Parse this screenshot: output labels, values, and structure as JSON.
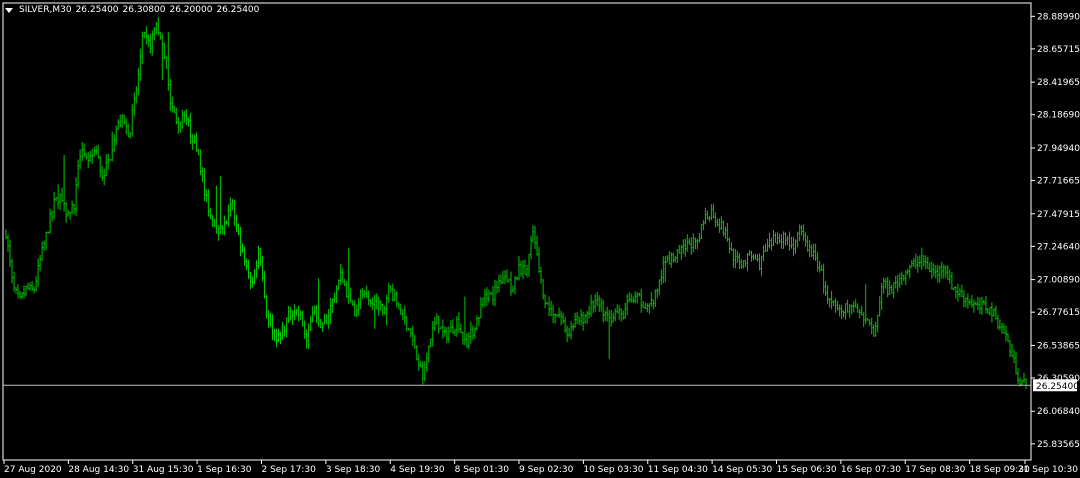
{
  "header": {
    "symbol": "SILVER,M30",
    "open": "26.25400",
    "high": "26.30800",
    "low": "26.20000",
    "close": "26.25400"
  },
  "colors": {
    "background": "#000000",
    "bars": "#00c800",
    "axis": "#ffffff",
    "price_line": "#c0c0c0",
    "price_box_bg": "#ffffff",
    "price_box_text": "#000000"
  },
  "chart_data": {
    "type": "line",
    "chart_style": "ohlc-bars",
    "title": "",
    "xlabel": "",
    "ylabel": "",
    "ylim": [
      25.72,
      28.985
    ],
    "y_ticks": [
      "28.88990",
      "28.65715",
      "28.41965",
      "28.18690",
      "27.94940",
      "27.71665",
      "27.47915",
      "27.24640",
      "27.00890",
      "26.77615",
      "26.53865",
      "26.30590",
      "26.06840",
      "25.83565"
    ],
    "x_ticks": [
      "27 Aug 2020",
      "28 Aug 14:30",
      "31 Aug 15:30",
      "1 Sep 16:30",
      "2 Sep 17:30",
      "3 Sep 18:30",
      "4 Sep 19:30",
      "8 Sep 01:30",
      "9 Sep 02:30",
      "10 Sep 03:30",
      "11 Sep 04:30",
      "14 Sep 05:30",
      "15 Sep 06:30",
      "16 Sep 07:30",
      "17 Sep 08:30",
      "18 Sep 09:30",
      "21 Sep 10:30"
    ],
    "current_price": "26.25400",
    "grid": false,
    "series": [
      {
        "values": [
          [
            0,
            27.35
          ],
          [
            1,
            26.95
          ],
          [
            2,
            26.85
          ],
          [
            3,
            26.95
          ],
          [
            4,
            26.92
          ],
          [
            5,
            27.15
          ],
          [
            6,
            27.35
          ],
          [
            7,
            27.55
          ],
          [
            8,
            27.62
          ],
          [
            9,
            27.48
          ],
          [
            10,
            27.55
          ],
          [
            11,
            27.98
          ],
          [
            12,
            27.82
          ],
          [
            13,
            27.95
          ],
          [
            14,
            27.75
          ],
          [
            15,
            27.85
          ],
          [
            16,
            28.08
          ],
          [
            17,
            28.15
          ],
          [
            18,
            28.05
          ],
          [
            19,
            28.35
          ],
          [
            20,
            28.75
          ],
          [
            21,
            28.68
          ],
          [
            22,
            28.85
          ],
          [
            23,
            28.62
          ],
          [
            24,
            28.3
          ],
          [
            25,
            28.1
          ],
          [
            26,
            28.22
          ],
          [
            27,
            28.05
          ],
          [
            28,
            27.95
          ],
          [
            29,
            27.62
          ],
          [
            30,
            27.45
          ],
          [
            31,
            27.35
          ],
          [
            32,
            27.4
          ],
          [
            33,
            27.55
          ],
          [
            34,
            27.3
          ],
          [
            35,
            27.1
          ],
          [
            36,
            26.98
          ],
          [
            37,
            27.25
          ],
          [
            38,
            26.78
          ],
          [
            39,
            26.65
          ],
          [
            40,
            26.58
          ],
          [
            41,
            26.72
          ],
          [
            42,
            26.8
          ],
          [
            43,
            26.75
          ],
          [
            44,
            26.55
          ],
          [
            45,
            26.85
          ],
          [
            46,
            26.62
          ],
          [
            47,
            26.75
          ],
          [
            48,
            26.9
          ],
          [
            49,
            27.05
          ],
          [
            50,
            26.88
          ],
          [
            51,
            26.78
          ],
          [
            52,
            26.92
          ],
          [
            53,
            26.82
          ],
          [
            54,
            26.85
          ],
          [
            55,
            26.78
          ],
          [
            56,
            26.95
          ],
          [
            57,
            26.85
          ],
          [
            58,
            26.75
          ],
          [
            59,
            26.65
          ],
          [
            60,
            26.45
          ],
          [
            61,
            26.3
          ],
          [
            62,
            26.6
          ],
          [
            63,
            26.72
          ],
          [
            64,
            26.6
          ],
          [
            65,
            26.65
          ],
          [
            66,
            26.72
          ],
          [
            67,
            26.55
          ],
          [
            68,
            26.62
          ],
          [
            69,
            26.75
          ],
          [
            70,
            26.92
          ],
          [
            71,
            26.88
          ],
          [
            72,
            27.0
          ],
          [
            73,
            27.05
          ],
          [
            74,
            26.92
          ],
          [
            75,
            27.1
          ],
          [
            76,
            27.05
          ],
          [
            77,
            27.35
          ],
          [
            78,
            27.02
          ],
          [
            79,
            26.82
          ],
          [
            80,
            26.78
          ],
          [
            81,
            26.75
          ],
          [
            82,
            26.62
          ],
          [
            83,
            26.7
          ],
          [
            84,
            26.72
          ],
          [
            85,
            26.78
          ],
          [
            86,
            26.85
          ],
          [
            87,
            26.8
          ],
          [
            88,
            26.72
          ],
          [
            89,
            26.78
          ],
          [
            90,
            26.75
          ],
          [
            91,
            26.85
          ],
          [
            92,
            26.88
          ],
          [
            93,
            26.85
          ],
          [
            94,
            26.82
          ],
          [
            95,
            26.9
          ],
          [
            96,
            27.1
          ],
          [
            97,
            27.15
          ],
          [
            98,
            27.18
          ],
          [
            99,
            27.22
          ],
          [
            100,
            27.28
          ],
          [
            101,
            27.25
          ],
          [
            102,
            27.45
          ],
          [
            103,
            27.5
          ],
          [
            104,
            27.42
          ],
          [
            105,
            27.35
          ],
          [
            106,
            27.2
          ],
          [
            107,
            27.12
          ],
          [
            108,
            27.15
          ],
          [
            109,
            27.18
          ],
          [
            110,
            27.12
          ],
          [
            111,
            27.22
          ],
          [
            112,
            27.28
          ],
          [
            113,
            27.32
          ],
          [
            114,
            27.3
          ],
          [
            115,
            27.25
          ],
          [
            116,
            27.35
          ],
          [
            117,
            27.25
          ],
          [
            118,
            27.18
          ],
          [
            119,
            27.08
          ],
          [
            120,
            26.85
          ],
          [
            121,
            26.82
          ],
          [
            122,
            26.78
          ],
          [
            123,
            26.82
          ],
          [
            124,
            26.8
          ],
          [
            125,
            26.72
          ],
          [
            126,
            26.68
          ],
          [
            127,
            26.62
          ],
          [
            128,
            27.0
          ],
          [
            129,
            26.92
          ],
          [
            130,
            26.98
          ],
          [
            131,
            27.05
          ],
          [
            132,
            27.1
          ],
          [
            133,
            27.12
          ],
          [
            134,
            27.15
          ],
          [
            135,
            27.08
          ],
          [
            136,
            27.05
          ],
          [
            137,
            27.12
          ],
          [
            138,
            26.98
          ],
          [
            139,
            26.92
          ],
          [
            140,
            26.88
          ],
          [
            141,
            26.85
          ],
          [
            142,
            26.8
          ],
          [
            143,
            26.82
          ],
          [
            144,
            26.78
          ],
          [
            145,
            26.7
          ],
          [
            146,
            26.62
          ],
          [
            147,
            26.45
          ],
          [
            148,
            26.3
          ],
          [
            149,
            26.25
          ]
        ]
      }
    ]
  }
}
